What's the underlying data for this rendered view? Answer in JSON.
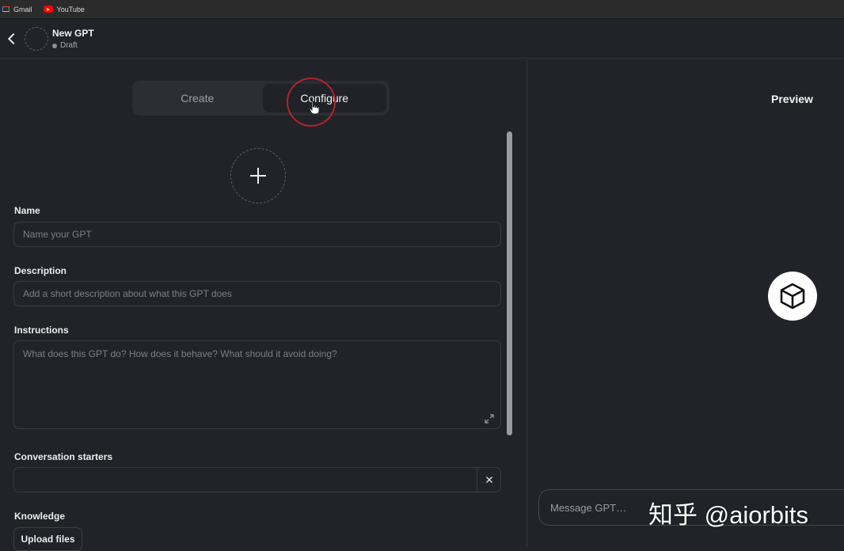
{
  "bookmarks": [
    {
      "label": "Gmail",
      "icon": "gmail-icon"
    },
    {
      "label": "YouTube",
      "icon": "youtube-icon"
    }
  ],
  "header": {
    "title": "New GPT",
    "status": "Draft"
  },
  "tabs": {
    "create": "Create",
    "configure": "Configure",
    "active": "configure"
  },
  "form": {
    "name_label": "Name",
    "name_placeholder": "Name your GPT",
    "name_value": "",
    "description_label": "Description",
    "description_placeholder": "Add a short description about what this GPT does",
    "description_value": "",
    "instructions_label": "Instructions",
    "instructions_placeholder": "What does this GPT do? How does it behave? What should it avoid doing?",
    "instructions_value": "",
    "starters_label": "Conversation starters",
    "starter_value": "",
    "knowledge_label": "Knowledge",
    "upload_label": "Upload files"
  },
  "preview": {
    "title": "Preview",
    "message_placeholder": "Message GPT…"
  },
  "watermark": "知乎 @aiorbits",
  "colors": {
    "background": "#212328",
    "accent_ring": "#b3242b"
  }
}
